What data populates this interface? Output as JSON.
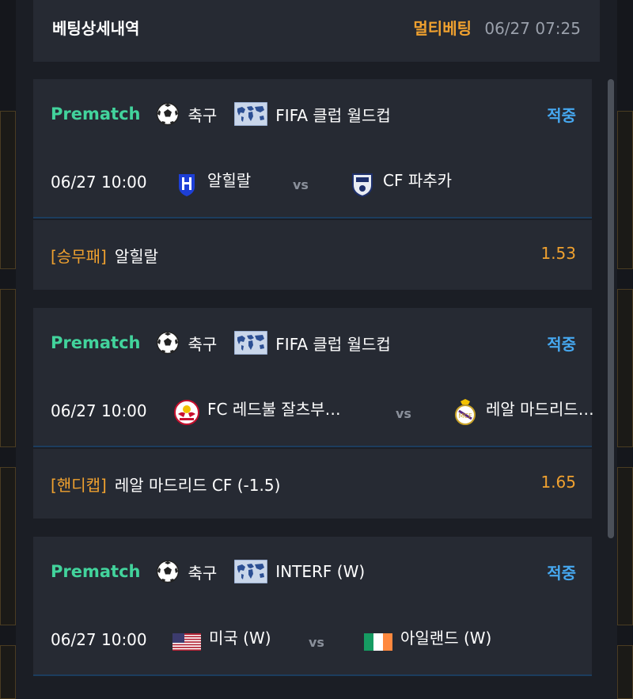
{
  "header": {
    "title": "베팅상세내역",
    "bet_type": "멀티베팅",
    "datetime": "06/27 07:25"
  },
  "colors": {
    "prematch": "#42d39c",
    "accent": "#f0a12f",
    "result": "#46a8f0"
  },
  "bets": [
    {
      "stage": "Prematch",
      "sport_icon": "soccer-ball-icon",
      "sport": "축구",
      "league_icon": "world-map-icon",
      "league": "FIFA 클럽 월드컵",
      "result": "적중",
      "time": "06/27 10:00",
      "home": {
        "name": "알힐랄",
        "icon": "al-hilal-crest-icon"
      },
      "vs": "vs",
      "away": {
        "name": "CF 파추카",
        "icon": "pachuca-crest-icon"
      },
      "market": "[승무패]",
      "pick": "알힐랄",
      "odds": "1.53"
    },
    {
      "stage": "Prematch",
      "sport_icon": "soccer-ball-icon",
      "sport": "축구",
      "league_icon": "world-map-icon",
      "league": "FIFA 클럽 월드컵",
      "result": "적중",
      "time": "06/27 10:00",
      "home": {
        "name": "FC 레드불 잘츠부…",
        "icon": "red-bull-crest-icon"
      },
      "vs": "vs",
      "away": {
        "name": "레알 마드리드…",
        "icon": "real-madrid-crest-icon"
      },
      "market": "[핸디캡]",
      "pick": "레알 마드리드 CF (-1.5)",
      "odds": "1.65"
    },
    {
      "stage": "Prematch",
      "sport_icon": "soccer-ball-icon",
      "sport": "축구",
      "league_icon": "world-map-icon",
      "league": "INTERF (W)",
      "result": "적중",
      "time": "06/27 10:00",
      "home": {
        "name": "미국 (W)",
        "icon": "usa-flag-icon"
      },
      "vs": "vs",
      "away": {
        "name": "아일랜드 (W)",
        "icon": "ireland-flag-icon"
      }
    }
  ]
}
